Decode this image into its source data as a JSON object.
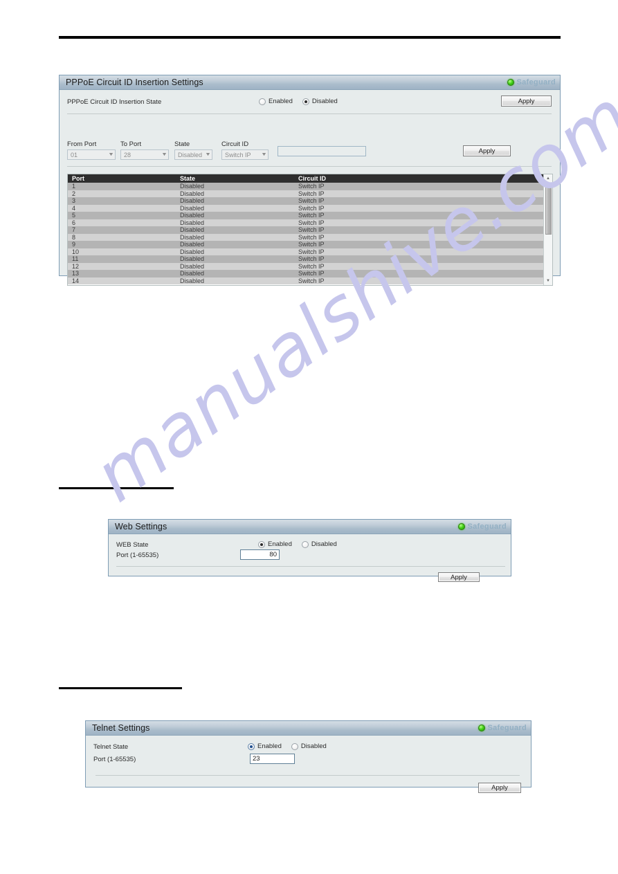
{
  "watermark": {
    "text": "manualshive.com"
  },
  "panels": {
    "pppoe": {
      "title": "PPPoE Circuit ID Insertion Settings",
      "safeguard_label": "Safeguard",
      "state_row": {
        "label": "PPPoE Circuit ID Insertion State",
        "options": [
          {
            "label": "Enabled",
            "checked": false
          },
          {
            "label": "Disabled",
            "checked": true
          }
        ],
        "apply_label": "Apply"
      },
      "config_row": {
        "from_port": {
          "label": "From Port",
          "value": "01"
        },
        "to_port": {
          "label": "To Port",
          "value": "28"
        },
        "state": {
          "label": "State",
          "value": "Disabled"
        },
        "circuit_id": {
          "label": "Circuit ID",
          "value": "Switch IP"
        },
        "circuit_id_text": {
          "value": "",
          "placeholder": ""
        },
        "apply_label": "Apply"
      },
      "table": {
        "columns": [
          "Port",
          "State",
          "Circuit ID"
        ],
        "rows": [
          [
            "1",
            "Disabled",
            "Switch IP"
          ],
          [
            "2",
            "Disabled",
            "Switch IP"
          ],
          [
            "3",
            "Disabled",
            "Switch IP"
          ],
          [
            "4",
            "Disabled",
            "Switch IP"
          ],
          [
            "5",
            "Disabled",
            "Switch IP"
          ],
          [
            "6",
            "Disabled",
            "Switch IP"
          ],
          [
            "7",
            "Disabled",
            "Switch IP"
          ],
          [
            "8",
            "Disabled",
            "Switch IP"
          ],
          [
            "9",
            "Disabled",
            "Switch IP"
          ],
          [
            "10",
            "Disabled",
            "Switch IP"
          ],
          [
            "11",
            "Disabled",
            "Switch IP"
          ],
          [
            "12",
            "Disabled",
            "Switch IP"
          ],
          [
            "13",
            "Disabled",
            "Switch IP"
          ],
          [
            "14",
            "Disabled",
            "Switch IP"
          ]
        ],
        "scroll_up_icon": "▲",
        "scroll_down_icon": "▼"
      }
    },
    "web": {
      "title": "Web Settings",
      "safeguard_label": "Safeguard",
      "state_label": "WEB State",
      "state_options": [
        {
          "label": "Enabled",
          "checked": true
        },
        {
          "label": "Disabled",
          "checked": false
        }
      ],
      "port_label": "Port (1-65535)",
      "port_value": "80",
      "apply_label": "Apply"
    },
    "telnet": {
      "title": "Telnet Settings",
      "safeguard_label": "Safeguard",
      "state_label": "Telnet State",
      "state_options": [
        {
          "label": "Enabled",
          "checked": true
        },
        {
          "label": "Disabled",
          "checked": false
        }
      ],
      "port_label": "Port (1-65535)",
      "port_value": "23",
      "apply_label": "Apply"
    }
  },
  "icons": {
    "caret_down": "▼",
    "safeguard_led": "led-green-icon"
  },
  "colors": {
    "accent": "#7e9cb4",
    "panel_bg": "#e7ecec",
    "header_top": "#d4dde5",
    "header_bottom": "#9fb3c5",
    "safeguard_green": "#46d21a",
    "safeguard_text": "#93b0c4",
    "table_header_bg": "#2e2e2e",
    "row_odd": "#b4b4b4",
    "row_even": "#d3d3d3",
    "watermark": "#c6c6ec"
  }
}
